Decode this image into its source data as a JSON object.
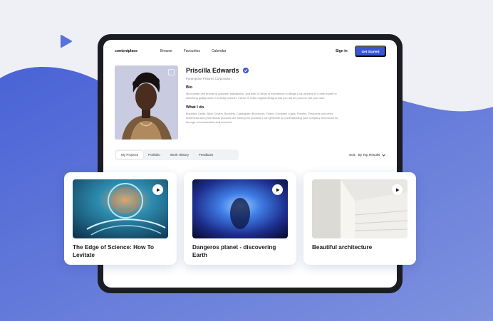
{
  "nav": {
    "logo": "contentplace",
    "links": [
      "Browse",
      "Favourites",
      "Calendar"
    ],
    "signin": "Sign in",
    "cta": "Get Started"
  },
  "profile": {
    "name": "Priscilla Edwards",
    "company": "Paramplant Pictures Corporation",
    "bio_heading": "Bio",
    "bio_text": "My number one priority is customer satisfaction, and with 10 years of experience in design I can achieve it! I pride myself in delivering quality work in a timely manner. I strive to make original designs that you will be proud to call your own!",
    "whatido_heading": "What I do",
    "whatido_text": "Business Cards, Book Covers, Booklets, Catalogues, Brochures, Flyers, Company Logos, Posters, Postcards and other multimedia and promotional products are among the products I can generate by understanding your company and concerns, through communication and research."
  },
  "tabs": [
    "My Projects",
    "Portfolio",
    "Work History",
    "Feedback"
  ],
  "sort": {
    "label": "Sort:",
    "value": "By Top Results"
  },
  "cards": [
    {
      "title": "The Edge of Science: How To Levitate"
    },
    {
      "title": "Dangeros planet - discovering Earth"
    },
    {
      "title": "Beautiful architecture"
    }
  ],
  "colors": {
    "accent": "#3856d8",
    "wave": "#5269d6"
  }
}
